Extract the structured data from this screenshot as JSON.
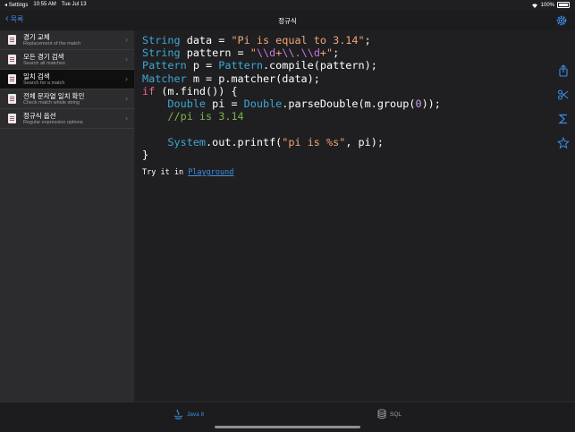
{
  "status_bar": {
    "back_app": "Settings",
    "time": "10:55 AM",
    "date": "Tue Jul 13",
    "battery": "100%"
  },
  "nav": {
    "back_label": "목록",
    "title": "정규식"
  },
  "sidebar": {
    "items": [
      {
        "title": "경기 교체",
        "subtitle": "Replacement of the match",
        "selected": false
      },
      {
        "title": "모든 경기 검색",
        "subtitle": "Search all matches",
        "selected": false
      },
      {
        "title": "일치 검색",
        "subtitle": "Search for a match",
        "selected": true
      },
      {
        "title": "전체 문자열 일치 확인",
        "subtitle": "Check match whole string",
        "selected": false
      },
      {
        "title": "정규식 옵션",
        "subtitle": "Regular expression options",
        "selected": false
      }
    ]
  },
  "code": {
    "lines": [
      [
        {
          "t": "String",
          "c": "type"
        },
        {
          "t": " data = ",
          "c": "plain"
        },
        {
          "t": "\"Pi is equal to 3.14\"",
          "c": "str"
        },
        {
          "t": ";",
          "c": "plain"
        }
      ],
      [
        {
          "t": "String",
          "c": "type"
        },
        {
          "t": " pattern = ",
          "c": "plain"
        },
        {
          "t": "\"",
          "c": "str"
        },
        {
          "t": "\\\\d",
          "c": "esc"
        },
        {
          "t": "+",
          "c": "str"
        },
        {
          "t": "\\\\.",
          "c": "esc"
        },
        {
          "t": "\\\\d",
          "c": "esc"
        },
        {
          "t": "+\"",
          "c": "str"
        },
        {
          "t": ";",
          "c": "plain"
        }
      ],
      [
        {
          "t": "Pattern",
          "c": "type"
        },
        {
          "t": " p = ",
          "c": "plain"
        },
        {
          "t": "Pattern",
          "c": "type"
        },
        {
          "t": ".compile(pattern);",
          "c": "plain"
        }
      ],
      [
        {
          "t": "Matcher",
          "c": "type"
        },
        {
          "t": " m = p.matcher(data);",
          "c": "plain"
        }
      ],
      [
        {
          "t": "if",
          "c": "kw"
        },
        {
          "t": " (m.find()) {",
          "c": "plain"
        }
      ],
      [
        {
          "t": "    ",
          "c": "plain"
        },
        {
          "t": "Double",
          "c": "type"
        },
        {
          "t": " pi = ",
          "c": "plain"
        },
        {
          "t": "Double",
          "c": "type"
        },
        {
          "t": ".parseDouble(m.group(",
          "c": "plain"
        },
        {
          "t": "0",
          "c": "num"
        },
        {
          "t": "));",
          "c": "plain"
        }
      ],
      [
        {
          "t": "    ",
          "c": "plain"
        },
        {
          "t": "//pi is 3.14",
          "c": "cm"
        }
      ],
      [
        {
          "t": "",
          "c": "plain"
        }
      ],
      [
        {
          "t": "    ",
          "c": "plain"
        },
        {
          "t": "System",
          "c": "type"
        },
        {
          "t": ".out.printf(",
          "c": "plain"
        },
        {
          "t": "\"pi is %s\"",
          "c": "str"
        },
        {
          "t": ", pi);",
          "c": "plain"
        }
      ],
      [
        {
          "t": "}",
          "c": "plain"
        }
      ]
    ],
    "try_prefix": "Try it in ",
    "try_link": "Playground"
  },
  "tabs": [
    {
      "label": "Java 8",
      "icon": "java-icon",
      "active": true
    },
    {
      "label": "SQL",
      "icon": "database-icon",
      "active": false
    }
  ],
  "colors": {
    "accent": "#3a8ee6",
    "type": "#3fa7d6",
    "string": "#f0a57a",
    "escape": "#c679dd",
    "keyword": "#e46a8e",
    "comment": "#7fb24a",
    "number": "#c9a3f0"
  }
}
